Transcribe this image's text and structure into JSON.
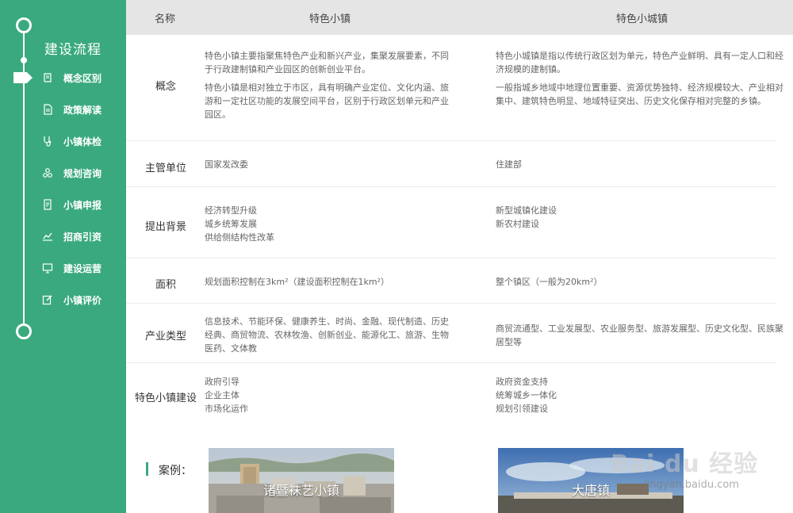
{
  "sidebar": {
    "title": "建设流程",
    "items": [
      {
        "label": "概念区别",
        "icon": "book-icon"
      },
      {
        "label": "政策解读",
        "icon": "document-icon"
      },
      {
        "label": "小镇体检",
        "icon": "stethoscope-icon"
      },
      {
        "label": "规划咨询",
        "icon": "network-icon"
      },
      {
        "label": "小镇申报",
        "icon": "form-icon"
      },
      {
        "label": "招商引资",
        "icon": "chart-icon"
      },
      {
        "label": "建设运营",
        "icon": "monitor-icon"
      },
      {
        "label": "小镇评价",
        "icon": "edit-icon"
      }
    ]
  },
  "table": {
    "headers": [
      "名称",
      "特色小镇",
      "特色小城镇"
    ],
    "rows": [
      {
        "label": "概念",
        "a": [
          "特色小镇主要指聚焦特色产业和新兴产业，集聚发展要素，不同于行政建制镇和产业园区的创新创业平台。",
          "特色小镇是相对独立于市区，具有明确产业定位、文化内涵、旅游和一定社区功能的发展空间平台，区别于行政区划单元和产业园区。"
        ],
        "b": [
          "特色小城镇是指以传统行政区划为单元，特色产业鲜明、具有一定人口和经济规模的建制镇。",
          "一般指城乡地域中地理位置重要、资源优势独特、经济规模较大、产业相对集中、建筑特色明显、地域特征突出、历史文化保存相对完整的乡镇。"
        ]
      },
      {
        "label": "主管单位",
        "a": [
          "国家发改委"
        ],
        "b": [
          "住建部"
        ]
      },
      {
        "label": "提出背景",
        "a": [
          "经济转型升级",
          "城乡统筹发展",
          "供给侧结构性改革"
        ],
        "b": [
          "新型城镇化建设",
          "新农村建设"
        ]
      },
      {
        "label": "面积",
        "a": [
          "规划面积控制在3km²（建设面积控制在1km²）"
        ],
        "b": [
          "整个镇区（一般为20km²）"
        ]
      },
      {
        "label": "产业类型",
        "a": [
          "信息技术、节能环保、健康养生、时尚、金融、现代制造、历史经典、商贸物流、农林牧渔、创新创业、能源化工、旅游、生物医药、文体教"
        ],
        "b": [
          "商贸流通型、工业发展型、农业服务型、旅游发展型、历史文化型、民族聚居型等"
        ]
      },
      {
        "label": "特色小镇建设",
        "a": [
          "政府引导",
          "企业主体",
          "市场化运作"
        ],
        "b": [
          "政府资金支持",
          "统筹城乡一体化",
          "规划引领建设"
        ]
      }
    ]
  },
  "cases": {
    "label": "案例：",
    "items": [
      {
        "caption": "诸暨袜艺小镇"
      },
      {
        "caption": "大唐镇"
      }
    ]
  },
  "watermark": {
    "brand": "Bai du 经验",
    "url": "jingyan.baidu.com"
  }
}
